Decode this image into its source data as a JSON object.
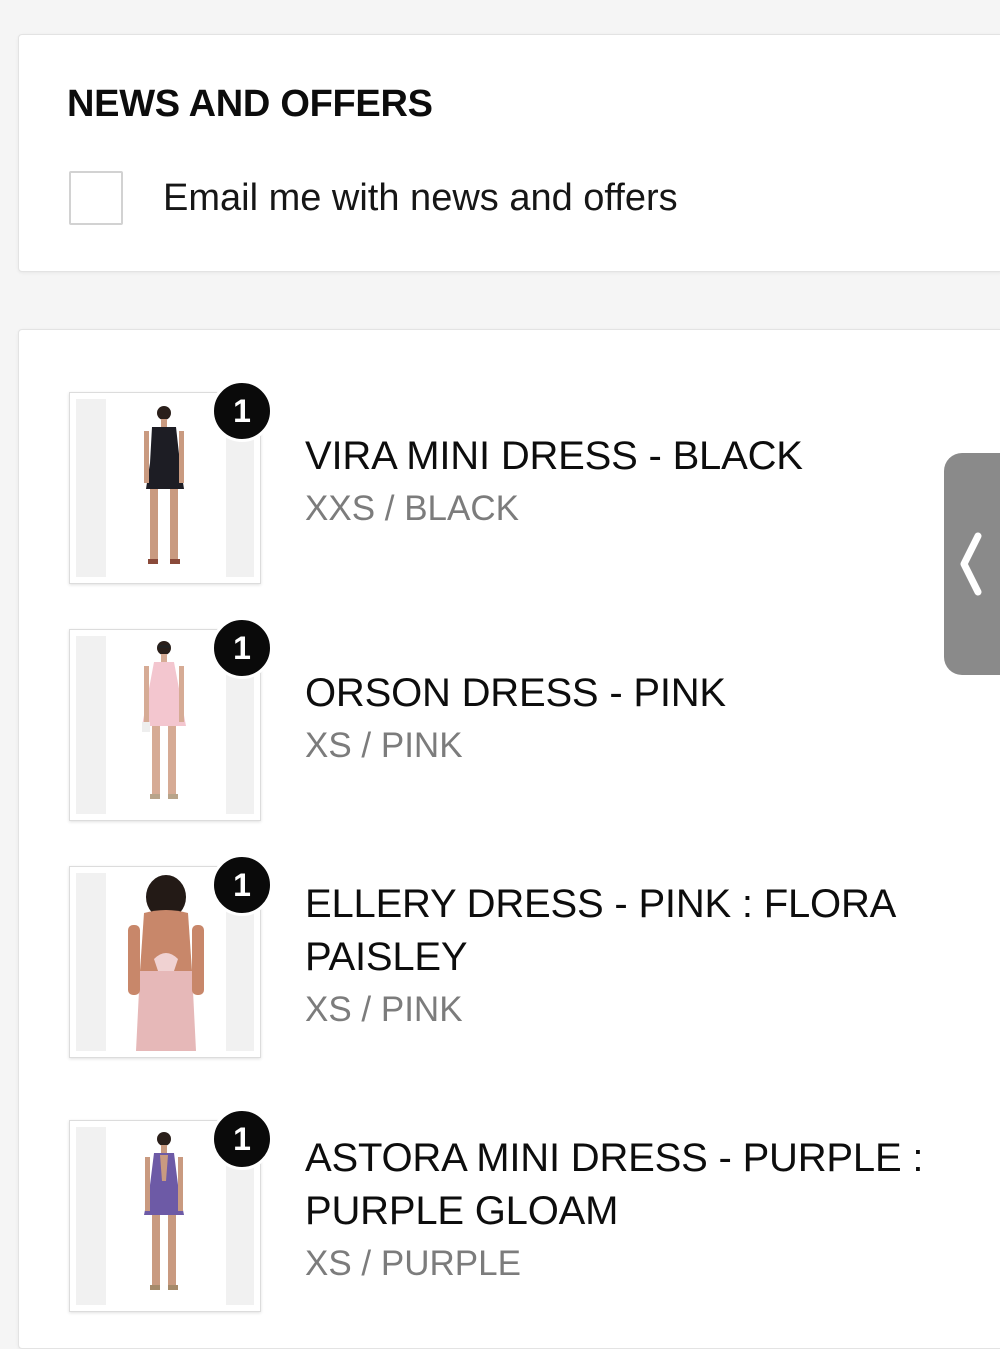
{
  "news": {
    "heading": "NEWS AND OFFERS",
    "checkbox_label": "Email me with news and offers",
    "checkbox_checked": false
  },
  "items": [
    {
      "name_line1": "VIRA MINI DRESS - BLACK",
      "name_line2": "",
      "variant": "XXS / BLACK",
      "quantity": "1",
      "dress_color": "#1d1d24"
    },
    {
      "name_line1": "ORSON DRESS - PINK",
      "name_line2": "",
      "variant": "XS / PINK",
      "quantity": "1",
      "dress_color": "#f3c6cf"
    },
    {
      "name_line1": "ELLERY DRESS - PINK : FLORA",
      "name_line2": "PAISLEY",
      "variant": "XS / PINK",
      "quantity": "1",
      "dress_color": "#e6b8b8"
    },
    {
      "name_line1": "ASTORA MINI DRESS - PURPLE :",
      "name_line2": "PURPLE GLOAM",
      "variant": "XS / PURPLE",
      "quantity": "1",
      "dress_color": "#6d5aa6"
    }
  ],
  "side_tab": {
    "icon": "chevron-left-icon",
    "color": "#8a8a8a"
  }
}
